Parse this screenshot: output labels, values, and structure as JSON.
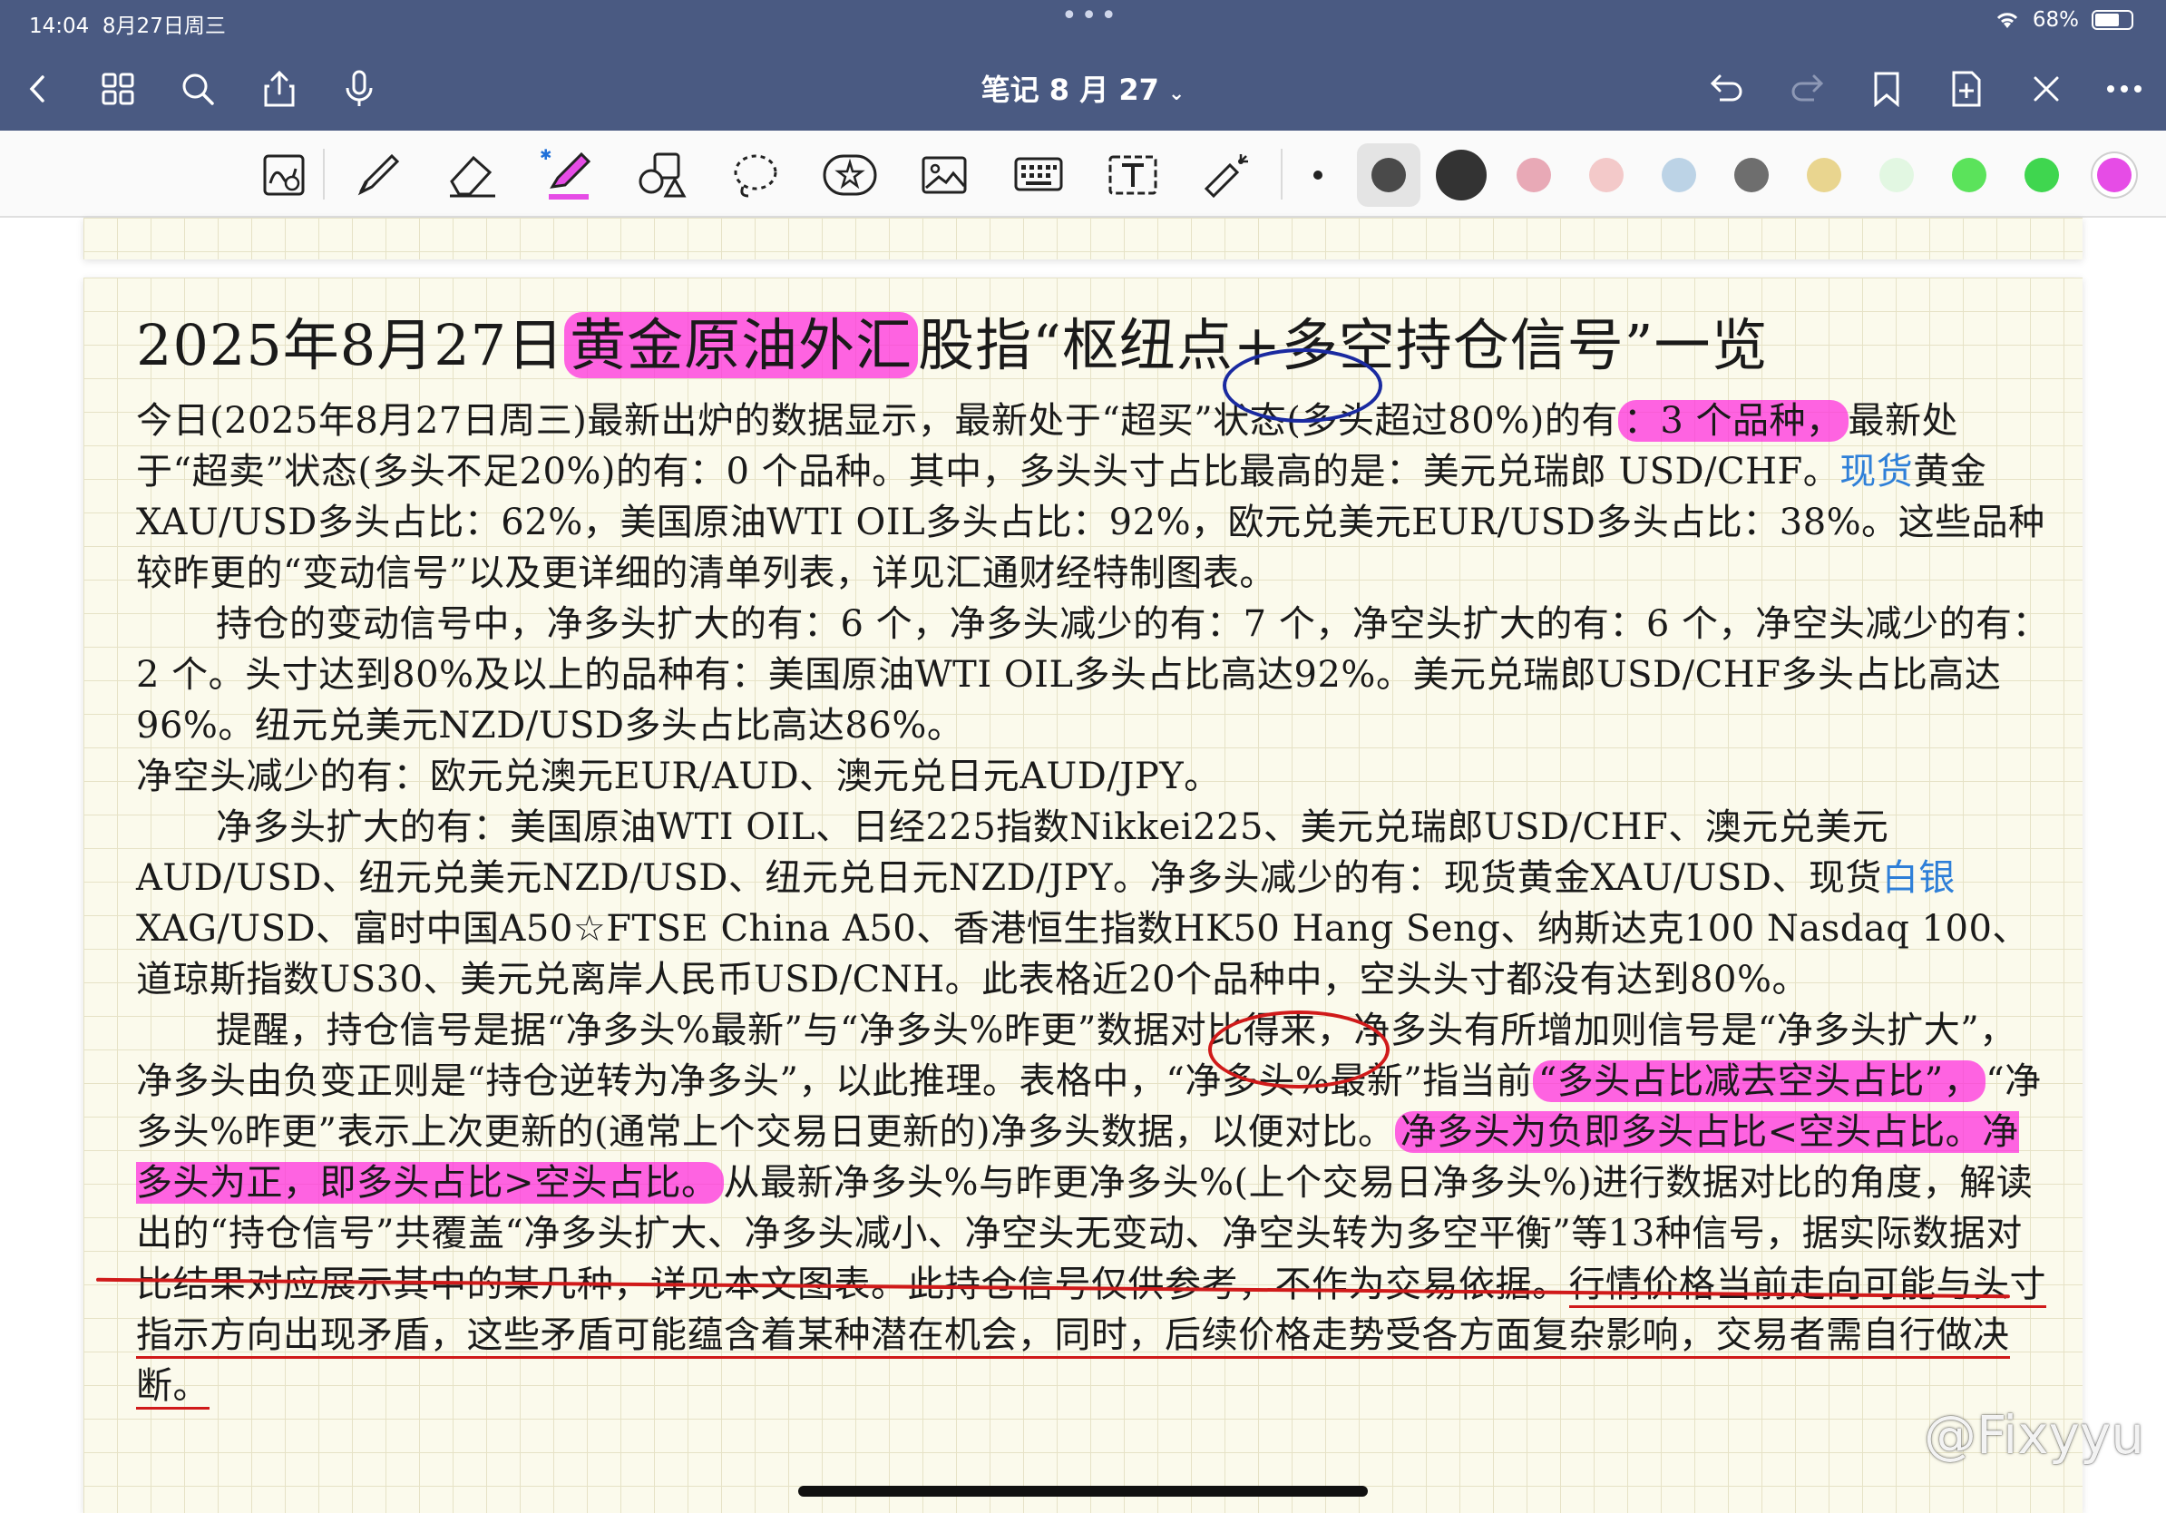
{
  "status": {
    "time": "14:04",
    "date": "8月27日周三",
    "dots": "•••",
    "battery": "68%",
    "battery_level": 0.68
  },
  "nav": {
    "title": "笔记 8 月 27",
    "icons": [
      "back-icon",
      "grid-icon",
      "search-icon",
      "share-icon",
      "mic-icon",
      "undo-icon",
      "redo-icon",
      "bookmark-icon",
      "add-page-icon",
      "close-tools-icon",
      "more-icon"
    ]
  },
  "toolbar": {
    "tools": [
      "lasso-zoom",
      "pen",
      "eraser",
      "highlighter",
      "shapes",
      "lasso",
      "sticker",
      "image",
      "keyboard",
      "text",
      "laser"
    ],
    "colors": [
      "#4a4a4a",
      "#333333",
      "#e8a9b6",
      "#f3c9c9",
      "#bcd3e6",
      "#6e6e6e",
      "#e9d58f",
      "#e2f7e2",
      "#5be35b",
      "#3fd64f",
      "#e64ce6"
    ]
  },
  "note": {
    "title_pre": "2025年8月27日",
    "title_hl": "黄金原油外汇",
    "title_post": "股指“枢纽点+多空持仓信号”一览",
    "p1_a": "今日(2025年8月27日周三)最新出炉的数据显示，最新处于“超买”状态(多头超过80%)的有",
    "p1_hl": "：3 个品种，",
    "p1_b": "最新处于“超卖”状态(多头不足20%)的有：0 个品种。其中，多头头寸占比最高的是：美元兑瑞郎 USD/CHF。",
    "p1_blue": "现货",
    "p1_c": "黄金XAU/USD多头占比：62%，美国原油WTI OIL多头占比：92%，欧元兑美元EUR/USD多头占比：38%。这些品种较昨更的“变动信号”以及更详细的清单列表，详见汇通财经特制图表。",
    "p2": "持仓的变动信号中，净多头扩大的有：6 个，净多头减少的有：7 个，净空头扩大的有：6 个，净空头减少的有：2 个。头寸达到80%及以上的品种有：美国原油WTI OIL多头占比高达92%。美元兑瑞郎USD/CHF多头占比高达96%。纽元兑美元NZD/USD多头占比高达86%。",
    "p3": "净空头减少的有：欧元兑澳元EUR/AUD、澳元兑日元AUD/JPY。",
    "p4_a": "净多头扩大的有：美国原油WTI OIL、日经225指数Nikkei225、美元兑瑞郎USD/CHF、澳元兑美元AUD/USD、纽元兑美元NZD/USD、纽元兑日元NZD/JPY。净多头减少的有：现货黄金XAU/USD、现货",
    "p4_blue": "白银",
    "p4_b": "XAG/USD、富时中国A50☆FTSE China A50、香港恒生指数HK50 Hang Seng、纳斯达克100 Nasdaq 100、道琼斯指数US30、美元兑离岸人民币USD/CNH。此表格近20个品种中，空头头寸都没有达到80%。",
    "p5_a": "提醒，持仓信号是据“净多头%最新”与“净多头%昨更”数据对比得来，净多头有所增加则信号是“净多头扩大”，净多头由负变正则是“持仓逆转为净多头”，以此推理。表格中，“净多头%最新”指当前",
    "p5_hl1": "“多头占比减去空头占比”，",
    "p5_b": "“净多头%昨更”表示上次更新的(通常上个交易日更新的)净多头数据，以便对比。",
    "p5_hl2": "净多头为负即多头占比<空头占比。净多头为正，即多头占比>空头占比。",
    "p5_c": "从最新净多头%与昨更净多头%(上个交易日净多头%)进行数据对比的角度，解读出的“持仓信号”共覆盖“净多头扩大、净多头减小、净空头无变动、净空头转为多空平衡”等13种信号，据实际数据对比结果对应展示其中的某几种，详见本文图表。此持仓信号仅供参考，不作为交易依据。",
    "p5_ul": "行情价格当前走向可能与头寸指示方向出现矛盾，这些矛盾可能蕴含着某种潜在机会，同时，后续价格走势受各方面复杂影响，交易者需自行做决断。"
  },
  "watermark": "@Fixyyu"
}
